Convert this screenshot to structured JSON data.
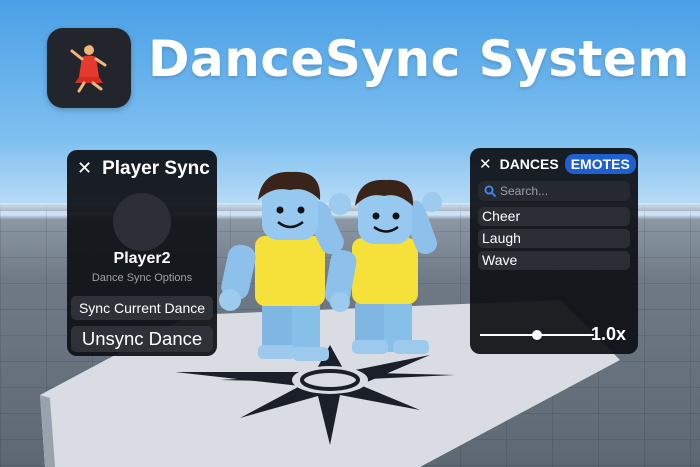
{
  "title": "DanceSync System",
  "app_icon": {
    "name": "dancer-icon",
    "accent": "#e63a2f"
  },
  "player_sync": {
    "title": "Player Sync",
    "close_icon": "close-icon",
    "player_name": "Player2",
    "subtitle": "Dance Sync Options",
    "sync_button": "Sync Current Dance",
    "unsync_button": "Unsync Dance"
  },
  "dance_panel": {
    "close_icon": "close-icon",
    "tabs": [
      {
        "label": "DANCES",
        "active": false
      },
      {
        "label": "EMOTES",
        "active": true
      }
    ],
    "search": {
      "placeholder": "Search...",
      "icon": "search-icon"
    },
    "items": [
      "Cheer",
      "Laugh",
      "Wave"
    ],
    "speed": {
      "label": "1.0x",
      "fraction": 0.5
    }
  },
  "colors": {
    "active_tab": "#1f5fd0",
    "panel_bg": "#0e1014",
    "item_bg": "#2a2e34"
  }
}
